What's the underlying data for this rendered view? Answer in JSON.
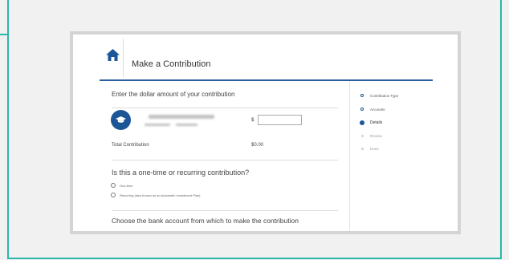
{
  "page": {
    "title": "Make a Contribution"
  },
  "amount_section": {
    "heading": "Enter the dollar amount of your contribution",
    "currency_symbol": "$",
    "amount_value": "",
    "total_label": "Total Contribution",
    "total_value": "$0.00"
  },
  "frequency_section": {
    "heading": "Is this a one-time or recurring contribution?",
    "options": [
      {
        "label": "One-time"
      },
      {
        "label": "Recurring (also known as an Automatic Investment Plan)"
      }
    ]
  },
  "bank_section": {
    "heading": "Choose the bank account from which to make the contribution"
  },
  "steps": [
    {
      "label": "Contribution Type",
      "state": "done",
      "icon": "hollow-dot"
    },
    {
      "label": "Accounts",
      "state": "done",
      "icon": "hollow-dot"
    },
    {
      "label": "Details",
      "state": "current",
      "icon": "filled-dot"
    },
    {
      "label": "Review",
      "state": "upcoming",
      "icon": "muted-dot"
    },
    {
      "label": "Done",
      "state": "upcoming",
      "icon": "muted-dot"
    }
  ],
  "colors": {
    "accent": "#1c5697",
    "frame": "#2ab7a9",
    "rule": "#2a5d9f"
  },
  "icons": {
    "home": "home-icon",
    "account": "graduation-cap-icon"
  }
}
